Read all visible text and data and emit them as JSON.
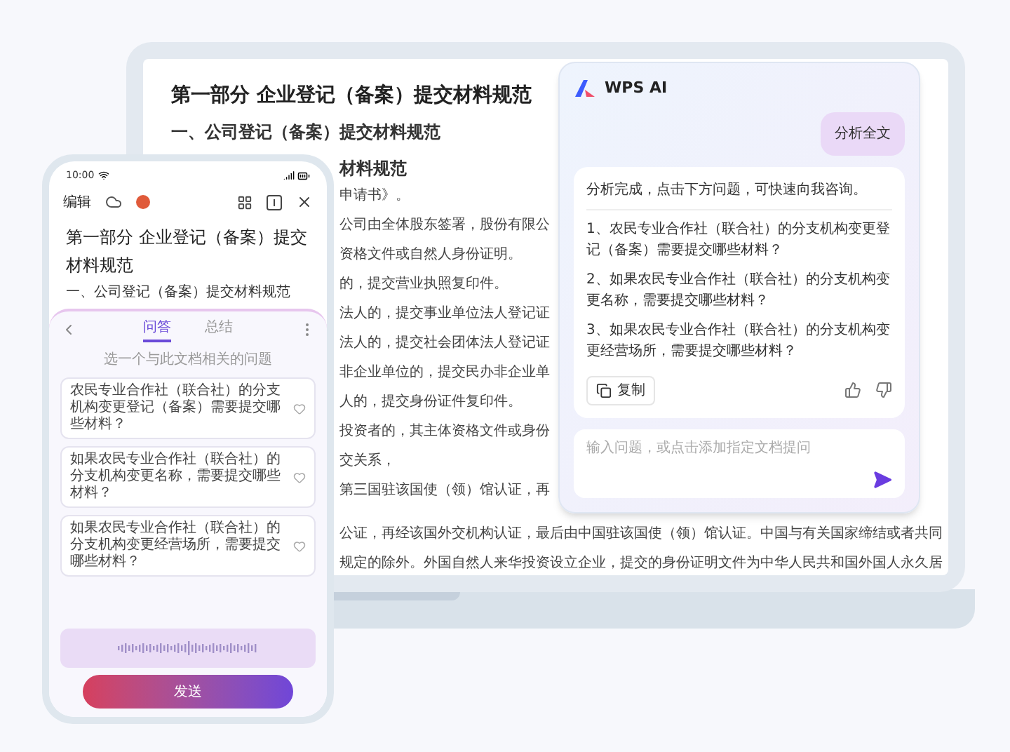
{
  "document": {
    "title": "第一部分 企业登记（备案）提交材料规范",
    "heading": "一、公司登记（备案）提交材料规范",
    "subheading": "材料规范",
    "lines": [
      "申请书》。",
      "公司由全体股东签署，股份有限公",
      "资格文件或自然人身份证明。",
      "的，提交营业执照复印件。",
      "法人的，提交事业单位法人登记证",
      "法人的，提交社会团体法人登记证",
      "非企业单位的，提交民办非企业单",
      "人的，提交身份证件复印件。",
      "投资者的，其主体资格文件或身份",
      "交关系，",
      "第三国驻该国使（领）馆认证，再"
    ],
    "wide_lines": [
      "公证，再经该国外交机构认证，最后由中国驻该国使（领）馆认证。中国与有关国家缔结或者共同",
      "规定的除外。外国自然人来华投资设立企业，提交的身份证明文件为中华人民共和国外国人永久居"
    ]
  },
  "ai_panel": {
    "brand": "WPS AI",
    "user_message": "分析全文",
    "intro": "分析完成，点击下方问题，可快速向我咨询。",
    "questions": [
      "1、农民专业合作社（联合社）的分支机构变更登记（备案）需要提交哪些材料？",
      "2、如果农民专业合作社（联合社）的分支机构变更名称，需要提交哪些材料？",
      "3、如果农民专业合作社（联合社）的分支机构变更经营场所，需要提交哪些材料？"
    ],
    "copy_label": "复制",
    "input": {
      "placeholder": "输入问题，或点击添加指定文档提问"
    }
  },
  "phone": {
    "status_time": "10:00",
    "edit_label": "编辑",
    "doc_title": "第一部分 企业登记（备案）提交材料规范",
    "doc_heading": "一、公司登记（备案）提交材料规范",
    "tabs": [
      {
        "label": "问答",
        "selected": true
      },
      {
        "label": "总结",
        "selected": false
      }
    ],
    "hint": "选一个与此文档相关的问题",
    "questions": [
      "农民专业合作社（联合社）的分支机构变更登记（备案）需要提交哪些材料？",
      "如果农民专业合作社（联合社）的分支机构变更名称，需要提交哪些材料？",
      "如果农民专业合作社（联合社）的分支机构变更经营场所，需要提交哪些材料？"
    ],
    "send_label": "发送"
  }
}
